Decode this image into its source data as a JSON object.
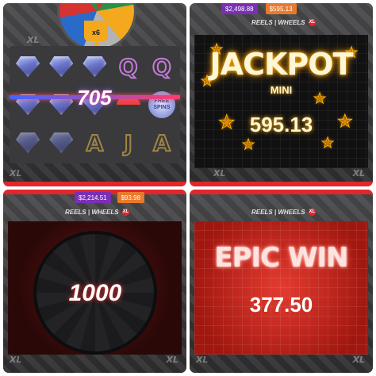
{
  "panel1": {
    "wheel_multiplier": "x6",
    "win_amount": "705",
    "free_spins_label": "FREE SPINS",
    "reel_letters": [
      "Q",
      "Q",
      "A",
      "J",
      "A"
    ],
    "brand_mark": "XL"
  },
  "panel2": {
    "balance": "$2,498.88",
    "bet": "$595.13",
    "logo_left": "REELS",
    "logo_right": "WHEELS",
    "logo_badge": "XL",
    "jackpot_title": "JACKPOT",
    "jackpot_tier": "MINI",
    "jackpot_amount": "595.13",
    "brand_mark": "XL"
  },
  "panel3": {
    "balance": "$2,214.51",
    "bet": "$93.98",
    "logo_left": "REELS",
    "logo_right": "WHEELS",
    "logo_badge": "XL",
    "wheel_value": "1000",
    "brand_mark": "XL"
  },
  "panel4": {
    "logo_left": "REELS",
    "logo_right": "WHEELS",
    "logo_badge": "XL",
    "win_title": "EPIC WIN",
    "win_amount": "377.50",
    "brand_mark": "XL"
  },
  "colors": {
    "accent_red": "#e3262c",
    "balance_purple": "#7a2fb5",
    "bet_orange": "#e9792c",
    "neon_gold": "#ffb400"
  },
  "icons": [
    "gem-icon",
    "free-spins-icon",
    "star-icon",
    "cherry-icon"
  ]
}
